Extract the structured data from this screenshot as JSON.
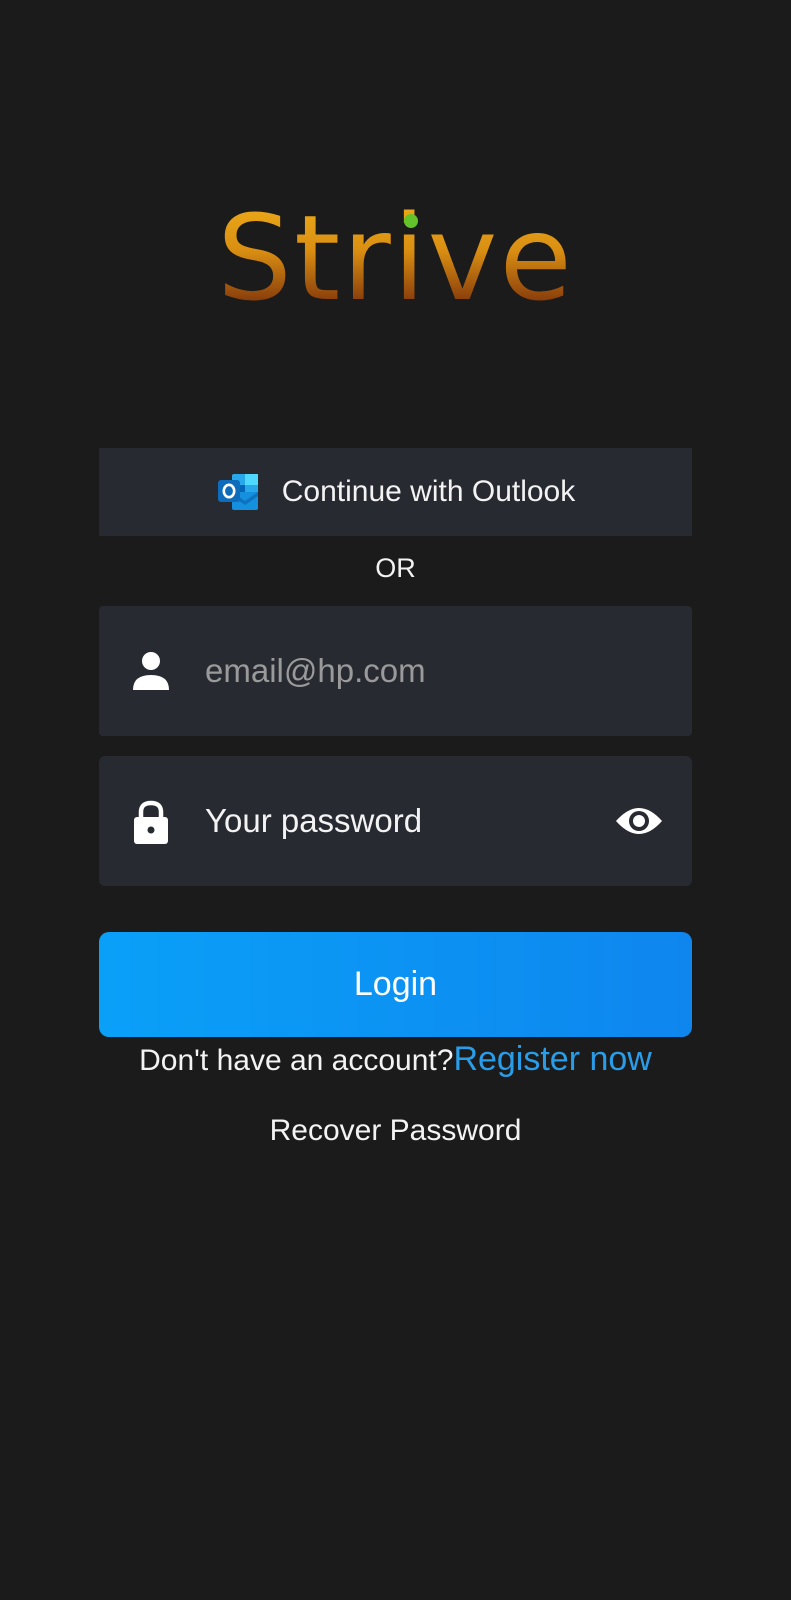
{
  "app": {
    "logo_text": "Strive"
  },
  "outlook": {
    "label": "Continue with Outlook",
    "icon": "outlook-icon"
  },
  "divider": {
    "text": "OR"
  },
  "email": {
    "placeholder": "email@hp.com",
    "value": "",
    "icon": "person-icon"
  },
  "password": {
    "placeholder": "Your password",
    "value": "",
    "icon": "lock-icon",
    "toggle_icon": "eye-icon"
  },
  "login": {
    "label": "Login"
  },
  "register": {
    "prompt": "Don't have an account?",
    "link": "Register now"
  },
  "recover": {
    "label": "Recover Password"
  },
  "colors": {
    "background": "#1b1b1b",
    "panel": "#272a31",
    "accent": "#0e8ff0",
    "link": "#2a9de8",
    "logo_green": "#63c32a"
  }
}
